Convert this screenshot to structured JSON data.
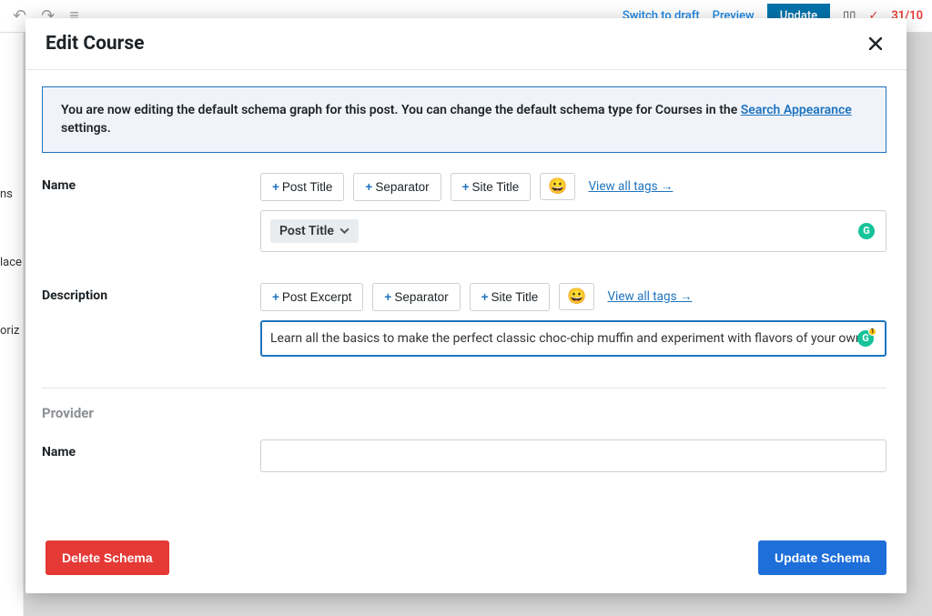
{
  "topbar": {
    "switch_draft": "Switch to draft",
    "preview": "Preview",
    "update": "Update",
    "score": "31/10"
  },
  "sidebar_bg": {
    "row1": "ns",
    "row2": "lace",
    "row3": "oriz"
  },
  "modal": {
    "title": "Edit Course",
    "notice": {
      "text_before": "You are now editing the default schema graph for this post. You can change the default schema type for Courses in the ",
      "link": "Search Appearance",
      "text_after": " settings."
    },
    "name": {
      "label": "Name",
      "tag1": "Post Title",
      "tag2": "Separator",
      "tag3": "Site Title",
      "view_all": "View all tags →",
      "token": "Post Title"
    },
    "description": {
      "label": "Description",
      "tag1": "Post Excerpt",
      "tag2": "Separator",
      "tag3": "Site Title",
      "view_all": "View all tags →",
      "value": "Learn all the basics to make the perfect classic choc-chip muffin and experiment with flavors of your own."
    },
    "provider": {
      "section": "Provider",
      "name_label": "Name"
    },
    "delete": "Delete Schema",
    "update": "Update Schema"
  }
}
